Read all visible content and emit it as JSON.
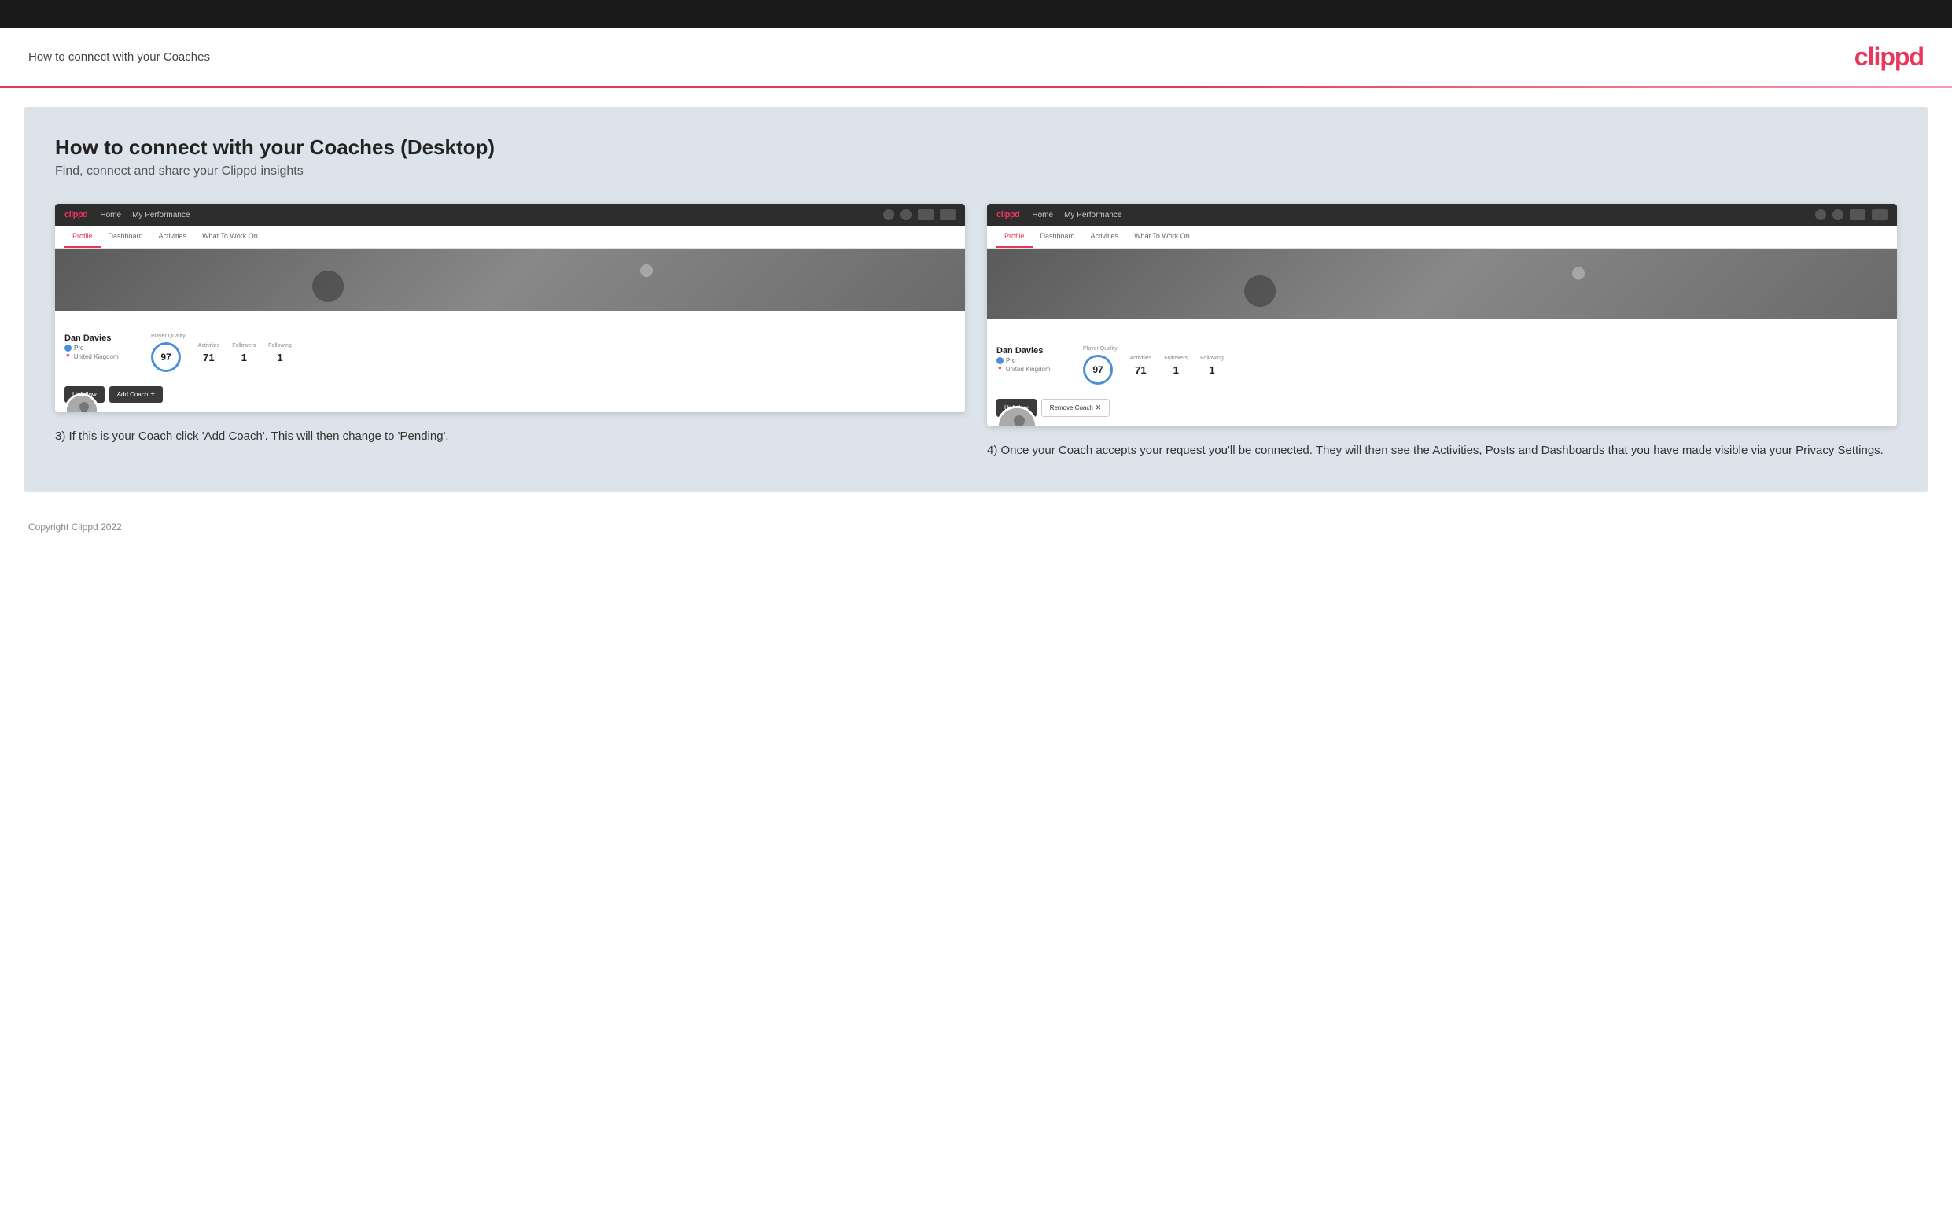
{
  "page": {
    "title": "How to connect with your Coaches",
    "logo": "clippd",
    "copyright": "Copyright Clippd 2022"
  },
  "main": {
    "title": "How to connect with your Coaches (Desktop)",
    "subtitle": "Find, connect and share your Clippd insights"
  },
  "screenshot1": {
    "nav": {
      "logo": "clippd",
      "items": [
        "Home",
        "My Performance"
      ]
    },
    "tabs": [
      "Profile",
      "Dashboard",
      "Activities",
      "What To Work On"
    ],
    "active_tab": "Profile",
    "user": {
      "name": "Dan Davies",
      "badge": "Pro",
      "location": "United Kingdom",
      "player_quality": "97",
      "activities": "71",
      "followers": "1",
      "following": "1"
    },
    "buttons": [
      "Unfollow",
      "Add Coach"
    ],
    "labels": {
      "player_quality": "Player Quality",
      "activities": "Activities",
      "followers": "Followers",
      "following": "Following"
    }
  },
  "screenshot2": {
    "nav": {
      "logo": "clippd",
      "items": [
        "Home",
        "My Performance"
      ]
    },
    "tabs": [
      "Profile",
      "Dashboard",
      "Activities",
      "What To Work On"
    ],
    "active_tab": "Profile",
    "user": {
      "name": "Dan Davies",
      "badge": "Pro",
      "location": "United Kingdom",
      "player_quality": "97",
      "activities": "71",
      "followers": "1",
      "following": "1"
    },
    "buttons": [
      "Unfollow",
      "Remove Coach"
    ],
    "labels": {
      "player_quality": "Player Quality",
      "activities": "Activities",
      "followers": "Followers",
      "following": "Following"
    }
  },
  "descriptions": {
    "step3": "3) If this is your Coach click 'Add Coach'. This will then change to 'Pending'.",
    "step4": "4) Once your Coach accepts your request you'll be connected. They will then see the Activities, Posts and Dashboards that you have made visible via your Privacy Settings."
  }
}
